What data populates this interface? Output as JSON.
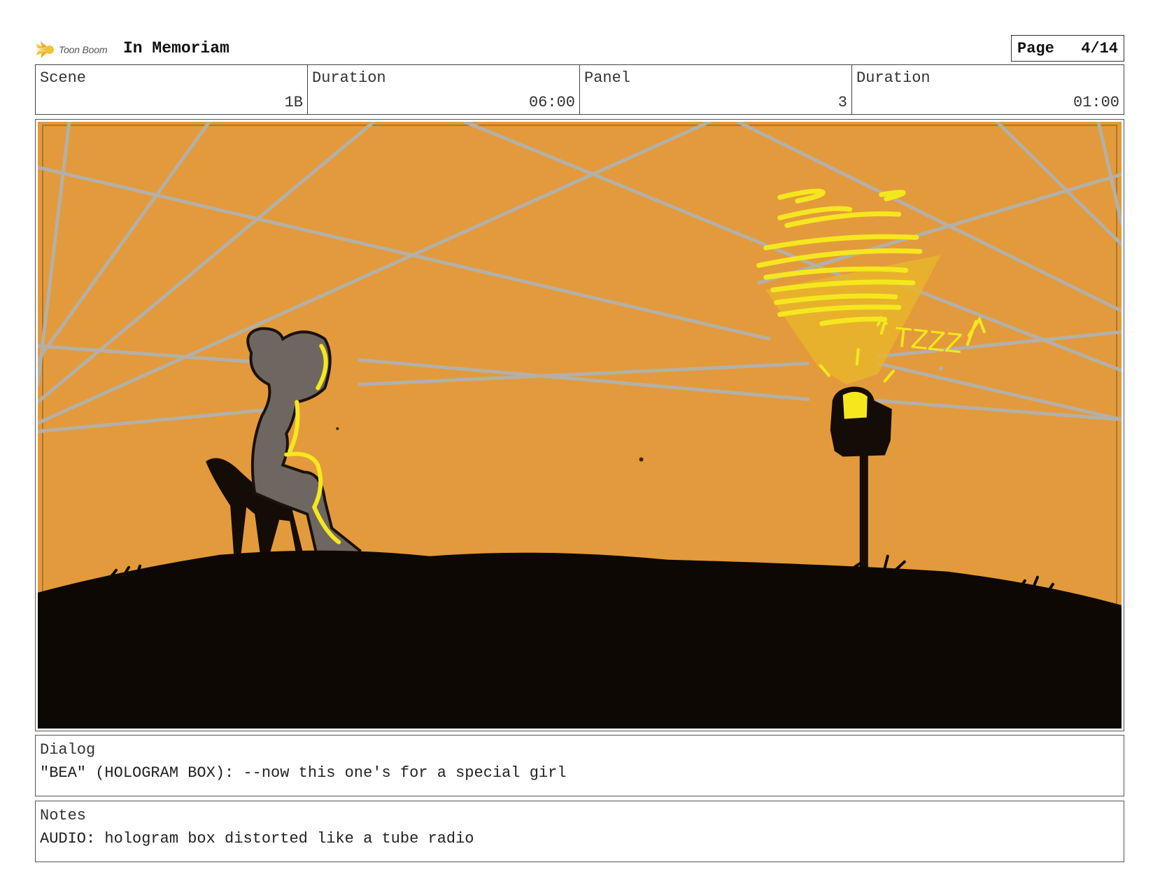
{
  "header": {
    "logo_text": "Toon Boom",
    "title": "In Memoriam",
    "page_label": "Page",
    "page_value": "4/14"
  },
  "info": {
    "scene_label": "Scene",
    "scene_value": "1B",
    "scene_duration_label": "Duration",
    "scene_duration_value": "06:00",
    "panel_label": "Panel",
    "panel_value": "3",
    "panel_duration_label": "Duration",
    "panel_duration_value": "01:00"
  },
  "panel": {
    "sound_effect": "TZZZ",
    "colors": {
      "sky": "#E39A3C",
      "ground": "#0D0804",
      "beams": "#B4B0A6",
      "glow": "#F5E71E",
      "figure": "#6E6761"
    }
  },
  "dialog": {
    "label": "Dialog",
    "text": "\"BEA\" (HOLOGRAM BOX): --now this one's for a special girl"
  },
  "notes": {
    "label": "Notes",
    "text": "AUDIO: hologram box distorted like a tube radio"
  }
}
